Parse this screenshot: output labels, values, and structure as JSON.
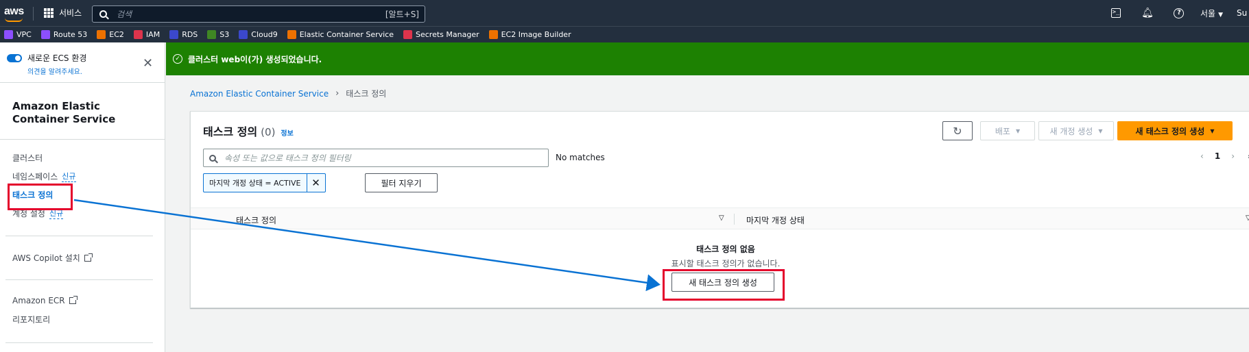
{
  "topnav": {
    "logo": "aws",
    "services_label": "서비스",
    "search_placeholder": "검색",
    "search_shortcut": "[알트+S]",
    "region": "서울",
    "user": "Su"
  },
  "favorites": [
    {
      "label": "VPC",
      "color": "#8c4fff"
    },
    {
      "label": "Route 53",
      "color": "#8c4fff"
    },
    {
      "label": "EC2",
      "color": "#ed7100"
    },
    {
      "label": "IAM",
      "color": "#dd344c"
    },
    {
      "label": "RDS",
      "color": "#3b48cc"
    },
    {
      "label": "S3",
      "color": "#3f8624"
    },
    {
      "label": "Cloud9",
      "color": "#3b48cc"
    },
    {
      "label": "Elastic Container Service",
      "color": "#ed7100"
    },
    {
      "label": "Secrets Manager",
      "color": "#dd344c"
    },
    {
      "label": "EC2 Image Builder",
      "color": "#ed7100"
    }
  ],
  "sidebar": {
    "toggle_label": "새로운 ECS 환경",
    "toggle_sub": "의견을 알려주세요.",
    "title": "Amazon Elastic Container Service",
    "items": [
      {
        "label": "클러스터"
      },
      {
        "label": "네임스페이스",
        "badge": "신규"
      },
      {
        "label": "태스크 정의"
      },
      {
        "label": "계정 설정",
        "badge": "신규"
      }
    ],
    "copilot": "AWS Copilot 설치",
    "ecr": "Amazon ECR",
    "repo": "리포지토리"
  },
  "flash": {
    "message": "클러스터 web이(가) 생성되었습니다."
  },
  "breadcrumb": {
    "root": "Amazon Elastic Container Service",
    "current": "태스크 정의"
  },
  "panel": {
    "title": "태스크 정의",
    "count": "(0)",
    "info": "정보",
    "deploy_label": "배포",
    "new_revision_label": "새 개정 생성",
    "create_label": "새 태스크 정의 생성",
    "filter_placeholder": "속성 또는 값으로 태스크 정의 필터링",
    "no_matches": "No matches",
    "page": "1",
    "token": "마지막 개정 상태 = ACTIVE",
    "clear_filters": "필터 지우기",
    "columns": [
      "태스크 정의",
      "마지막 개정 상태"
    ],
    "empty_title": "태스크 정의 없음",
    "empty_sub": "표시할 태스크 정의가 없습니다.",
    "empty_button": "새 태스크 정의 생성"
  },
  "colors": {
    "nav_bg": "#232f3e",
    "success": "#1d8102",
    "link": "#0972d3",
    "primary": "#ff9900",
    "annotation": "#e4002b",
    "arrow": "#0972d3"
  }
}
